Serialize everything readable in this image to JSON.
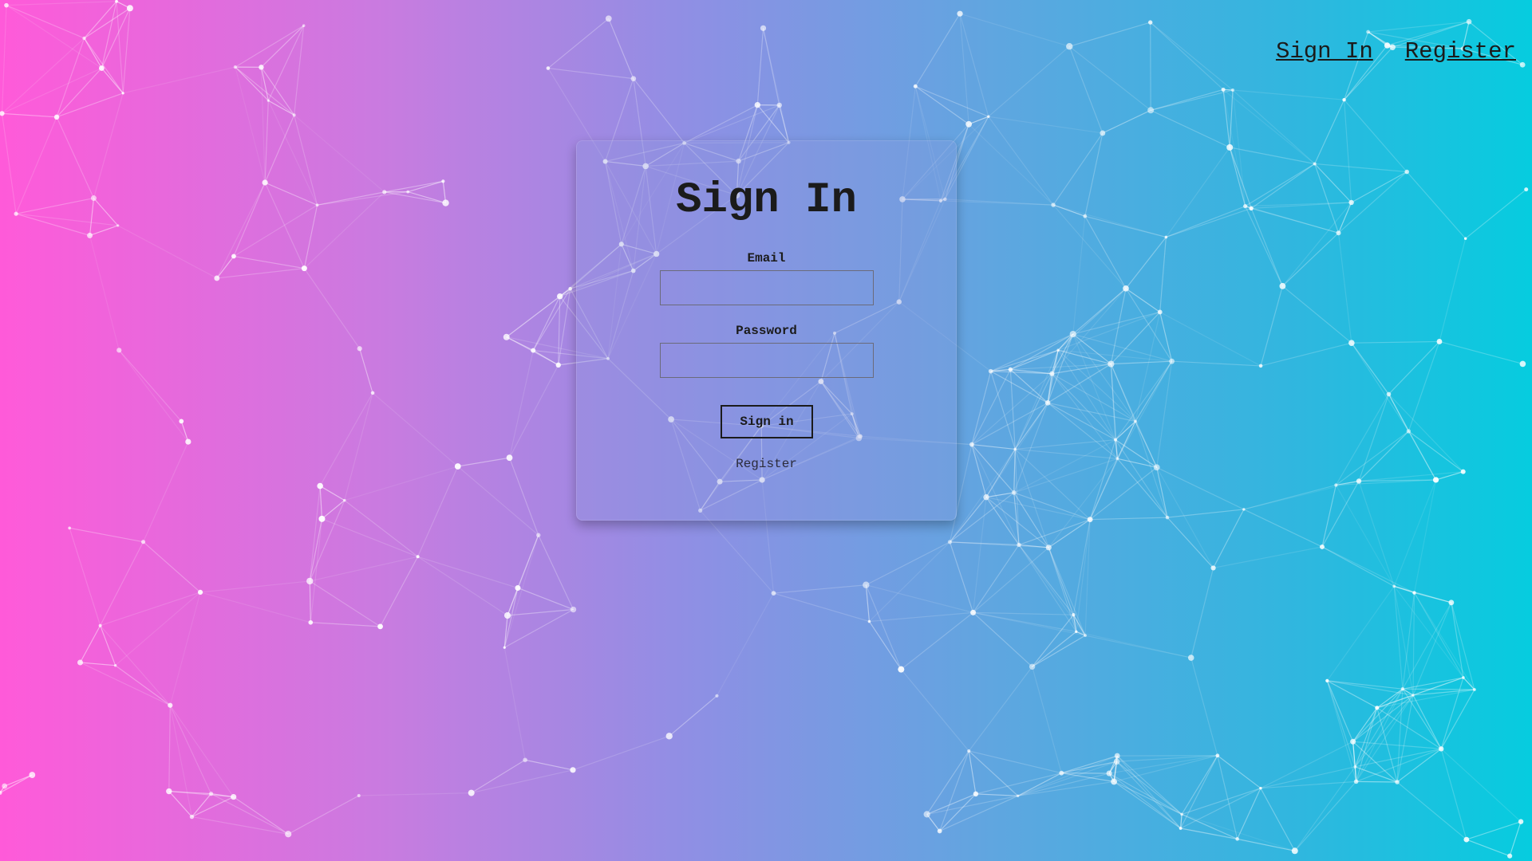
{
  "nav": {
    "sign_in": "Sign In",
    "register": "Register"
  },
  "form": {
    "title": "Sign In",
    "email_label": "Email",
    "email_value": "",
    "password_label": "Password",
    "password_value": "",
    "submit_label": "Sign in",
    "register_link": "Register"
  },
  "theme": {
    "gradient_left": "#ff5ad9",
    "gradient_right": "#06ccdf",
    "network_color": "#ffffff"
  }
}
